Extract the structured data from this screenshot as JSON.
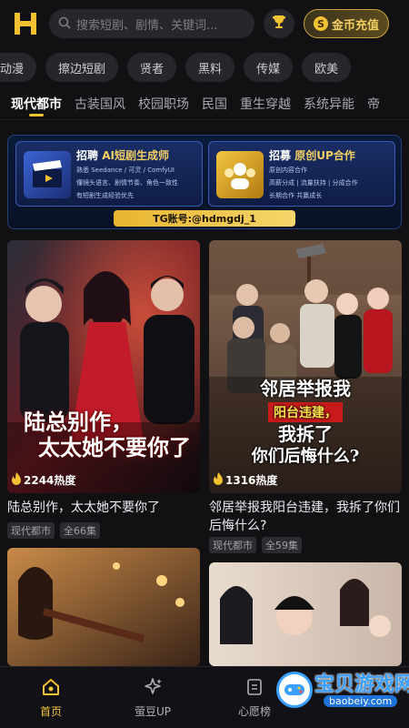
{
  "header": {
    "search_placeholder": "搜索短剧、剧情、关键词...",
    "coin_icon_glyph": "S",
    "coin_button_label": "金币充值"
  },
  "categories": [
    "动漫",
    "擦边短剧",
    "贤者",
    "黑料",
    "传媒",
    "欧美"
  ],
  "tabs": [
    "现代都市",
    "古装国风",
    "校园职场",
    "民国",
    "重生穿越",
    "系统异能",
    "帝"
  ],
  "banner": {
    "left": {
      "title_prefix": "招聘",
      "title_highlight": "AI短剧生成师",
      "lines": [
        "熟悉 Seedance / 可灵 / ComfyUI",
        "懂镜头语言、剧情节奏、角色一致性",
        "有短剧生成经验优先"
      ]
    },
    "right": {
      "title_prefix": "招募",
      "title_highlight": "原创UP合作",
      "lines": [
        "原创内容合作",
        "高薪分成 | 流量扶持 | 分成合作",
        "长期合作 共赢成长"
      ]
    },
    "tg_label": "TG账号:@hdmgdj_1"
  },
  "dramas": [
    {
      "poster_text": [
        "陆总别作，",
        "太太她不要你了"
      ],
      "heat": "2244热度",
      "title": "陆总别作，太太她不要你了",
      "tags": [
        "现代都市",
        "全66集"
      ]
    },
    {
      "poster_text": [
        "邻居举报我",
        "阳台违建，",
        "我拆了",
        "你们后悔什么?"
      ],
      "heat": "1316热度",
      "title": "邻居举报我阳台违建，我拆了你们后悔什么?",
      "tags": [
        "现代都市",
        "全59集"
      ]
    }
  ],
  "bottom_nav": [
    {
      "label": "首页",
      "active": true
    },
    {
      "label": "萤豆UP",
      "active": false
    },
    {
      "label": "心愿榜",
      "active": false
    }
  ],
  "watermark": {
    "text": "宝贝游戏网",
    "url": "baobeiy.com"
  },
  "colors": {
    "accent": "#f2c232",
    "background": "#111114",
    "chip": "#26262b"
  }
}
